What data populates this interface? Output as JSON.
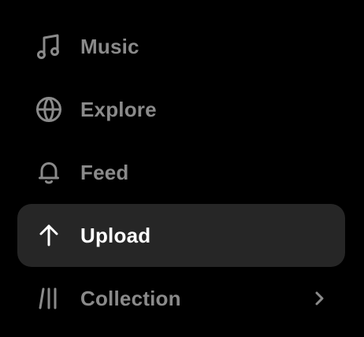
{
  "sidebar": {
    "items": [
      {
        "label": "Music",
        "icon": "music-note-icon",
        "active": false
      },
      {
        "label": "Explore",
        "icon": "globe-icon",
        "active": false
      },
      {
        "label": "Feed",
        "icon": "bell-icon",
        "active": false
      },
      {
        "label": "Upload",
        "icon": "arrow-up-icon",
        "active": true
      },
      {
        "label": "Collection",
        "icon": "library-icon",
        "active": false,
        "has_chevron": true,
        "chevron_icon": "chevron-right-icon"
      }
    ]
  },
  "colors": {
    "background": "#000000",
    "active_background": "#262626",
    "inactive_text": "#8a8a8a",
    "active_text": "#ffffff"
  }
}
